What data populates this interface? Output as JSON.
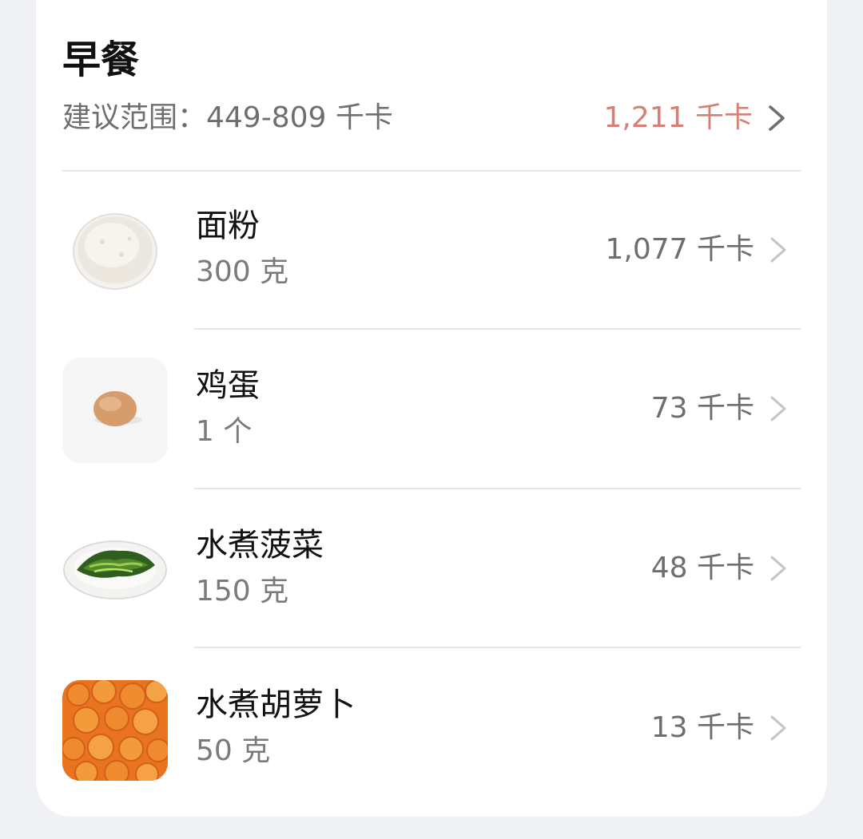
{
  "meal": {
    "title": "早餐",
    "range_label": "建议范围：449-809 千卡",
    "total_kcal": "1,211 千卡"
  },
  "colors": {
    "total_kcal": "#d57f76",
    "secondary_text": "#6e6e6e"
  },
  "items": [
    {
      "name": "面粉",
      "amount": "300 克",
      "kcal": "1,077 千卡",
      "image": "flour-bowl"
    },
    {
      "name": "鸡蛋",
      "amount": "1 个",
      "kcal": "73 千卡",
      "image": "egg"
    },
    {
      "name": "水煮菠菜",
      "amount": "150 克",
      "kcal": "48 千卡",
      "image": "boiled-spinach-plate"
    },
    {
      "name": "水煮胡萝卜",
      "amount": "50 克",
      "kcal": "13 千卡",
      "image": "boiled-carrot-slices"
    }
  ]
}
